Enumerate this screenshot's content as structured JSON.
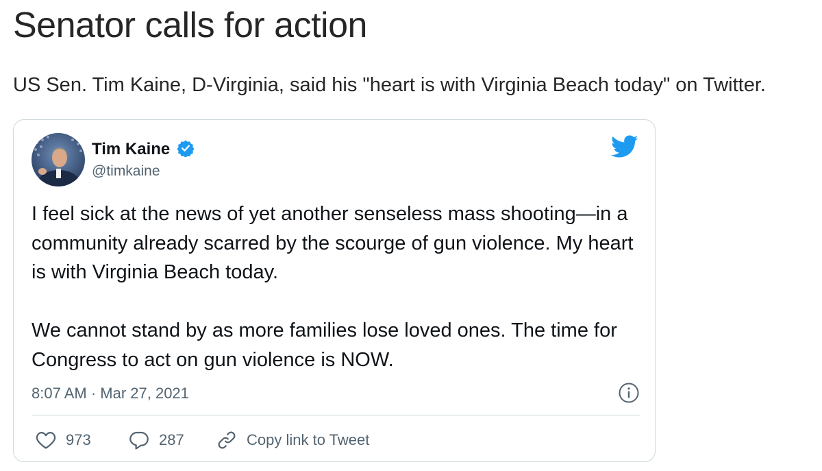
{
  "article": {
    "headline": "Senator calls for action",
    "lede": "US Sen. Tim Kaine, D-Virginia, said his \"heart is with Virginia Beach today\" on Twitter."
  },
  "tweet": {
    "author_name": "Tim Kaine",
    "author_handle": "@timkaine",
    "verified": true,
    "paragraphs": [
      "I feel sick at the news of yet another senseless mass shooting—in a community already scarred by the scourge of gun violence. My heart is with Virginia Beach today.",
      "We cannot stand by as more families lose loved ones. The time for Congress to act on gun violence is NOW."
    ],
    "timestamp": "8:07 AM · Mar 27, 2021",
    "likes": "973",
    "replies": "287",
    "copy_link_label": "Copy link to Tweet"
  },
  "icons": {
    "logo": "twitter-bird-icon",
    "verified": "verified-badge-icon",
    "info": "info-icon",
    "like": "heart-icon",
    "reply": "speech-bubble-icon",
    "copy": "link-icon"
  },
  "colors": {
    "brand_blue": "#1d9bf0",
    "text_primary": "#0f1419",
    "text_secondary": "#536471",
    "border": "#cfd9de"
  }
}
